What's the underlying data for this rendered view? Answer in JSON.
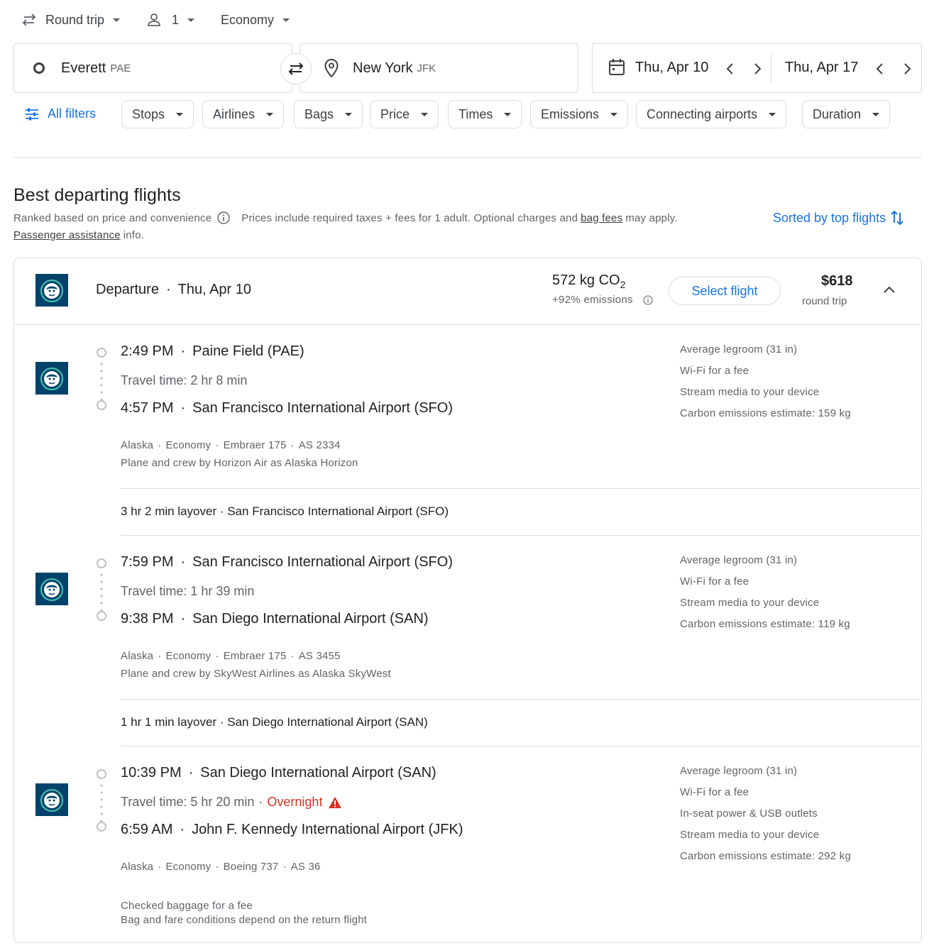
{
  "top": {
    "trip_type": "Round trip",
    "passengers": "1",
    "cabin": "Economy"
  },
  "search": {
    "origin_city": "Everett",
    "origin_code": "PAE",
    "dest_city": "New York",
    "dest_code": "JFK",
    "depart_date": "Thu, Apr 10",
    "return_date": "Thu, Apr 17"
  },
  "filters": {
    "all_filters": "All filters",
    "chips": [
      "Stops",
      "Airlines",
      "Bags",
      "Price",
      "Times",
      "Emissions",
      "Connecting airports",
      "Duration"
    ]
  },
  "results": {
    "heading": "Best departing flights",
    "ranked": "Ranked based on price and convenience",
    "prices_pre": "Prices include required taxes + fees for 1 adult. Optional charges and",
    "bag_fees": "bag fees",
    "prices_post": "may apply.",
    "passenger_assistance": "Passenger assistance",
    "info": "info.",
    "sorted": "Sorted by top flights"
  },
  "card": {
    "departure_label": "Departure",
    "departure_date": "Thu, Apr 10",
    "co2_value": "572 kg CO",
    "co2_sub": "2",
    "emissions_delta": "+92% emissions",
    "select_button": "Select flight",
    "price": "$618",
    "price_note": "round trip",
    "segments": [
      {
        "dep_time": "2:49 PM",
        "dep_airport": "Paine Field (PAE)",
        "travel_time": "Travel time: 2 hr 8 min",
        "arr_time": "4:57 PM",
        "arr_airport": "San Francisco International Airport (SFO)",
        "airline": "Alaska",
        "cabin": "Economy",
        "aircraft": "Embraer 175",
        "flight_no": "AS 2334",
        "operated": "Plane and crew by Horizon Air as Alaska Horizon",
        "amenities": [
          "Average legroom (31 in)",
          "Wi-Fi for a fee",
          "Stream media to your device",
          "Carbon emissions estimate: 159 kg"
        ]
      },
      {
        "dep_time": "7:59 PM",
        "dep_airport": "San Francisco International Airport (SFO)",
        "travel_time": "Travel time: 1 hr 39 min",
        "arr_time": "9:38 PM",
        "arr_airport": "San Diego International Airport (SAN)",
        "airline": "Alaska",
        "cabin": "Economy",
        "aircraft": "Embraer 175",
        "flight_no": "AS 3455",
        "operated": "Plane and crew by SkyWest Airlines as Alaska SkyWest",
        "amenities": [
          "Average legroom (31 in)",
          "Wi-Fi for a fee",
          "Stream media to your device",
          "Carbon emissions estimate: 119 kg"
        ]
      },
      {
        "dep_time": "10:39 PM",
        "dep_airport": "San Diego International Airport (SAN)",
        "travel_time": "Travel time: 5 hr 20 min",
        "overnight": "Overnight",
        "arr_time": "6:59 AM",
        "arr_airport": "John F. Kennedy International Airport (JFK)",
        "airline": "Alaska",
        "cabin": "Economy",
        "aircraft": "Boeing 737",
        "flight_no": "AS 36",
        "amenities": [
          "Average legroom (31 in)",
          "Wi-Fi for a fee",
          "In-seat power & USB outlets",
          "Stream media to your device",
          "Carbon emissions estimate: 292 kg"
        ]
      }
    ],
    "layovers": [
      "3 hr 2 min layover · San Francisco International Airport (SFO)",
      "1 hr 1 min layover · San Diego International Airport (SAN)"
    ],
    "baggage": "Checked baggage for a fee",
    "fare_conditions": "Bag and fare conditions depend on the return flight"
  },
  "colors": {
    "accent": "#1a73e8",
    "warning": "#d93025",
    "logo_bg": "#01426a",
    "logo_ring": "#48c3b1"
  },
  "icons": {
    "swap": "swap-arrows-icon",
    "calendar": "calendar-icon",
    "origin": "origin-circle-icon",
    "destination": "location-pin-icon",
    "filters": "tune-icon",
    "sort": "sort-arrows-icon",
    "info": "info-icon",
    "warning": "warning-triangle-icon",
    "collapse": "chevron-up-icon"
  }
}
